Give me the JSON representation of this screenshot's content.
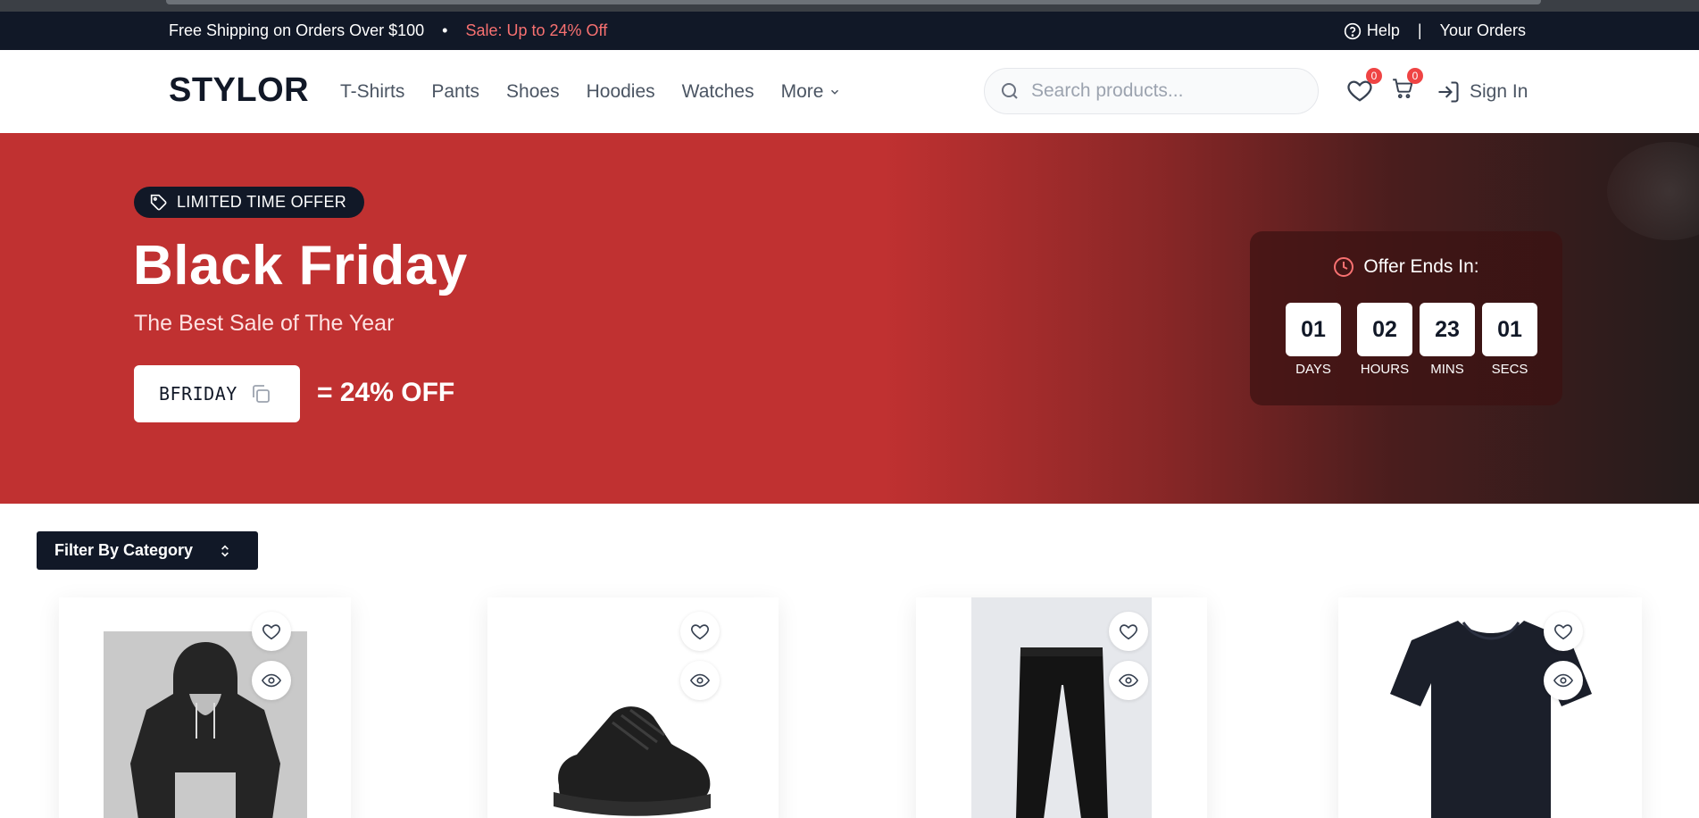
{
  "announcement": {
    "shipping": "Free Shipping on Orders Over $100",
    "bullet": "•",
    "sale": "Sale: Up to 24% Off",
    "help": "Help",
    "divider": "|",
    "orders": "Your Orders"
  },
  "header": {
    "logo": "STYLOR",
    "nav": [
      "T-Shirts",
      "Pants",
      "Shoes",
      "Hoodies",
      "Watches"
    ],
    "more": "More",
    "search_placeholder": "Search products...",
    "wishlist_count": "0",
    "cart_count": "0",
    "signin": "Sign In"
  },
  "hero": {
    "badge": "LIMITED TIME OFFER",
    "title": "Black Friday",
    "subtitle": "The Best Sale of The Year",
    "coupon_code": "BFRIDAY",
    "discount": "= 24% OFF",
    "countdown": {
      "title": "Offer Ends In:",
      "units": [
        {
          "value": "01",
          "label": "DAYS"
        },
        {
          "value": "02",
          "label": "HOURS"
        },
        {
          "value": "23",
          "label": "MINS"
        },
        {
          "value": "01",
          "label": "SECS"
        }
      ]
    }
  },
  "filter": {
    "label": "Filter By Category"
  },
  "products": [
    {
      "icon": "hoodie-image",
      "wishlist": "heart-icon",
      "quickview": "eye-icon"
    },
    {
      "icon": "sneaker-image",
      "wishlist": "heart-icon",
      "quickview": "eye-icon"
    },
    {
      "icon": "pants-image",
      "wishlist": "heart-icon",
      "quickview": "eye-icon"
    },
    {
      "icon": "tshirt-image",
      "wishlist": "heart-icon",
      "quickview": "eye-icon"
    }
  ],
  "colors": {
    "dark": "#111827",
    "hero_red": "#c03131",
    "sale_text": "#f87171",
    "badge_red": "#ef4444"
  }
}
